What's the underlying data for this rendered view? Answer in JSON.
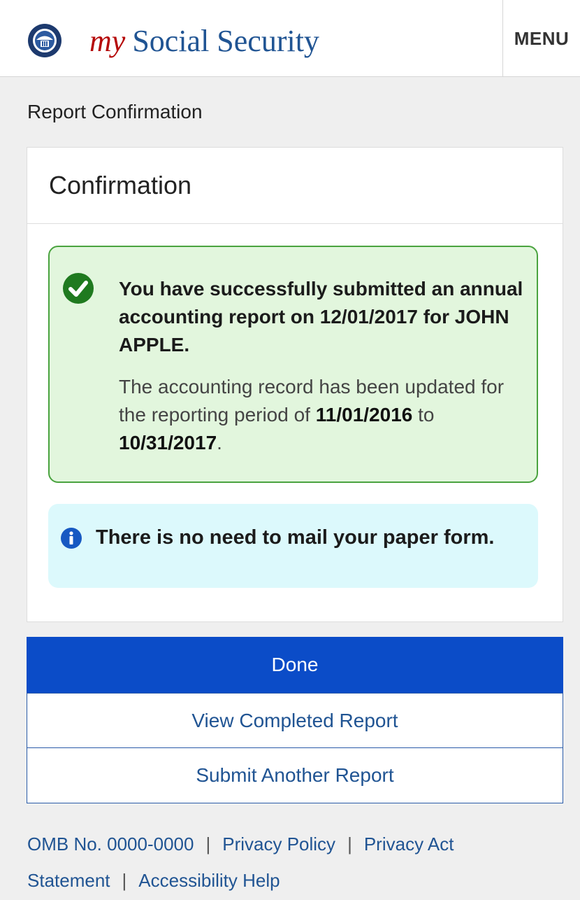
{
  "header": {
    "brand_my": "my",
    "brand_rest": "Social Security",
    "menu_label": "MENU",
    "logo_icon": "ssa-seal-icon"
  },
  "page": {
    "title": "Report Confirmation"
  },
  "card": {
    "title": "Confirmation",
    "success": {
      "icon": "check-circle-icon",
      "heading": "You have successfully submitted an annual accounting report on 12/01/2017 for JOHN APPLE.",
      "body_prefix": "The accounting record has been updated for the reporting period of",
      "period_start": "11/01/2016",
      "period_joiner": "to",
      "period_end": "10/31/2017",
      "body_suffix": "."
    },
    "info": {
      "icon": "info-circle-icon",
      "text": "There is no need to mail your paper form."
    }
  },
  "actions": {
    "done_label": "Done",
    "view_label": "View Completed Report",
    "submit_label": "Submit Another Report"
  },
  "footer": {
    "omb": "OMB No. 0000-0000",
    "privacy_policy": "Privacy Policy",
    "privacy_act": "Privacy Act Statement",
    "accessibility": "Accessibility Help",
    "separator": "|"
  },
  "colors": {
    "primary_blue": "#0b4cc8",
    "link_blue": "#205493",
    "brand_red": "#b50909",
    "success_bg": "#e2f6dd",
    "success_border": "#4aa33f",
    "info_bg": "#dcf9fc"
  }
}
